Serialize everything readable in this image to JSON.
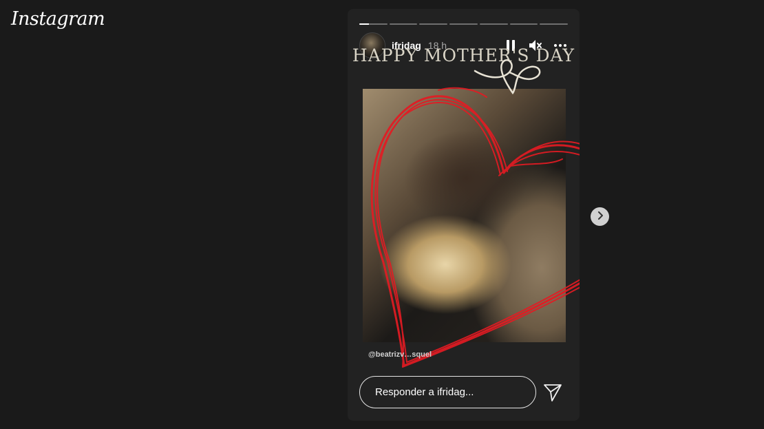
{
  "app": {
    "logo_text": "Instagram"
  },
  "story": {
    "segments_total": 7,
    "active_segment_progress": 0.35,
    "username": "ifridag",
    "time": "18 h",
    "greeting_text": "HAPPY MOTHER'S DAY",
    "mention": "@beatrizv…squel",
    "icons": {
      "pause": "pause-icon",
      "mute": "mute-icon",
      "more": "more-icon",
      "send": "send-icon",
      "next": "chevron-right-icon"
    }
  },
  "reply": {
    "placeholder": "Responder a ifridag..."
  },
  "colors": {
    "heart": "#e31b23",
    "background": "#1a1a1a",
    "panel": "#222222"
  }
}
